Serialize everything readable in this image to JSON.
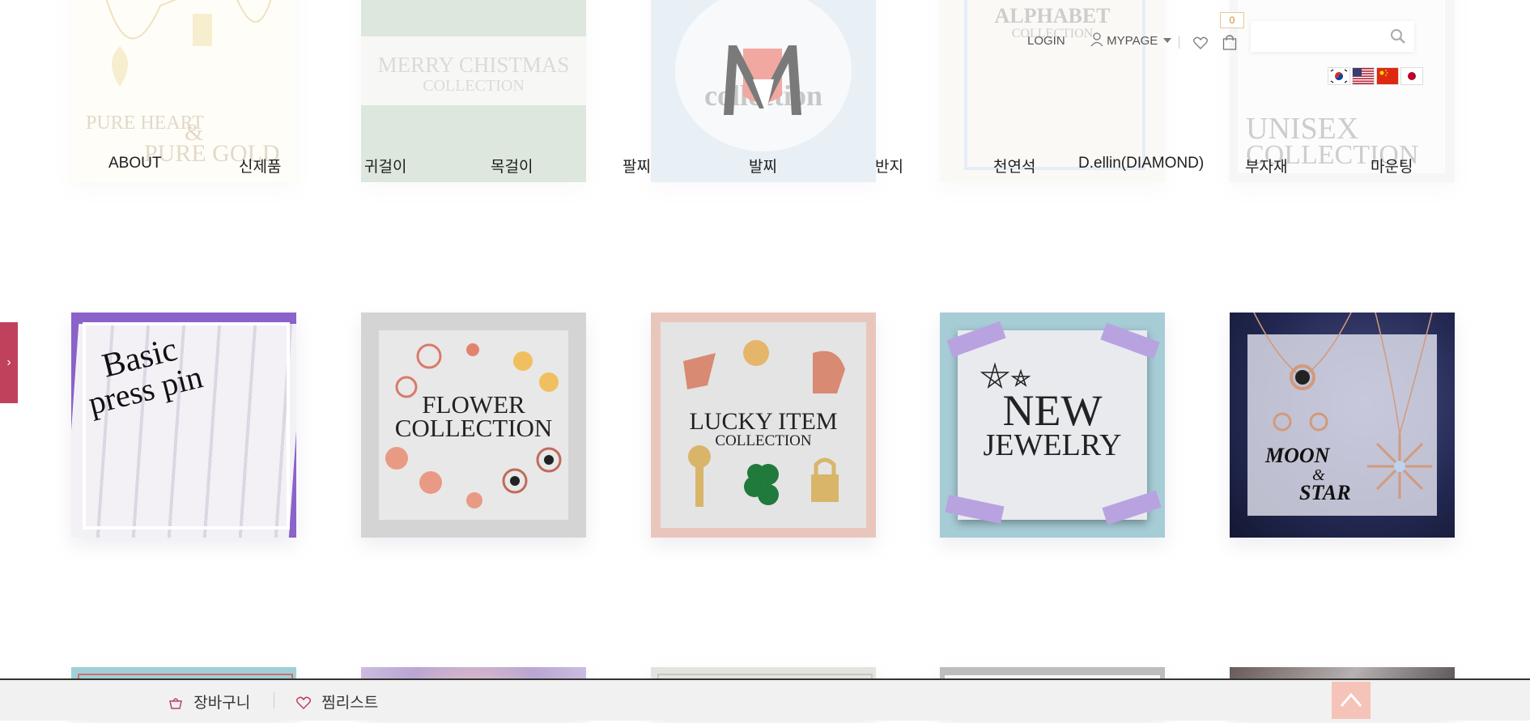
{
  "header": {
    "login_label": "LOGIN",
    "mypage_label": "MYPAGE",
    "cart_count": "0",
    "flags": [
      "KR",
      "US",
      "CN",
      "JP"
    ]
  },
  "nav": {
    "items": [
      "ABOUT",
      "신제품",
      "귀걸이",
      "목걸이",
      "팔찌",
      "발찌",
      "반지",
      "천연석",
      "D.ellin(DIAMOND)",
      "부자재",
      "마운팅"
    ]
  },
  "row1": {
    "tile1": [
      "PURE HEART",
      "&",
      "PURE GOLD"
    ],
    "tile2": [
      "MERRY CHISTMAS",
      "COLLECTION"
    ],
    "tile3": [
      "collection"
    ],
    "tile4": [
      "ALPHABET",
      "COLLECTION"
    ],
    "tile5": [
      "UNISEX",
      "COLLECTION"
    ]
  },
  "row2": {
    "tile1": [
      "Basic",
      "press pin"
    ],
    "tile2": [
      "FLOWER",
      "COLLECTION"
    ],
    "tile3": [
      "LUCKY ITEM",
      "COLLECTION"
    ],
    "tile4": [
      "NEW",
      "JEWELRY"
    ],
    "tile5": [
      "MOON",
      "&",
      "STAR"
    ]
  },
  "bottom_bar": {
    "cart_label": "장바구니",
    "wishlist_label": "찜리스트"
  },
  "colors": {
    "accent": "#c0415c",
    "top_button": "#f6c3b9"
  }
}
